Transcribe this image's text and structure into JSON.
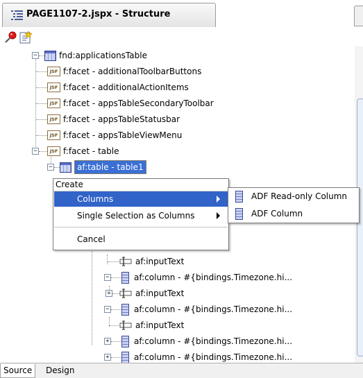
{
  "window": {
    "title": "PAGE1107-2.jspx - Structure"
  },
  "toolbar": {
    "pin_icon": "pin-icon",
    "edit_icon": "edit-properties-icon"
  },
  "tree": {
    "nodes": [
      "fnd:applicationsTable",
      "f:facet - additionalToolbarButtons",
      "f:facet - additionalActionItems",
      "f:facet - appsTableSecondaryToolbar",
      "f:facet - appsTableStatusbar",
      "f:facet - appsTableViewMenu",
      "f:facet - table",
      "af:table - table1",
      "af:inputText",
      "af:column - #{bindings.Timezone.hi...",
      "af:inputText",
      "af:column - #{bindings.Timezone.hi...",
      "af:inputText",
      "af:column - #{bindings.Timezone.hi...",
      "af:column - #{bindings.Timezone.hi..."
    ],
    "jsf_badge": "JSF"
  },
  "context_menu": {
    "header": "Create",
    "items": [
      "Columns",
      "Single Selection as Columns",
      "Cancel"
    ],
    "highlighted": "Columns",
    "highlight_color": "#3163c8"
  },
  "submenu": {
    "items": [
      "ADF Read-only Column",
      "ADF Column"
    ]
  },
  "bottom_tabs": [
    "Source",
    "Design"
  ],
  "colors": {
    "selection": "#3a6fd6"
  }
}
